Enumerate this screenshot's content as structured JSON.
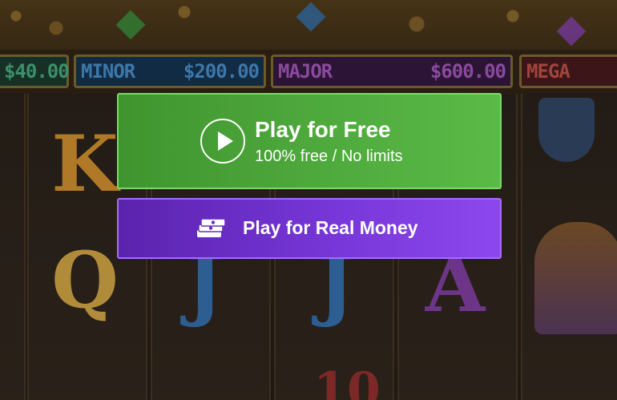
{
  "jackpots": {
    "mini": {
      "value": "$40.00"
    },
    "minor": {
      "label": "MINOR",
      "value": "$200.00"
    },
    "major": {
      "label": "MAJOR",
      "value": "$600.00"
    },
    "mega": {
      "label": "MEGA"
    }
  },
  "reel_symbols": [
    "K",
    "Q",
    "J",
    "J",
    "A",
    "10"
  ],
  "overlay": {
    "free": {
      "title": "Play for Free",
      "subtitle": "100% free / No limits",
      "icon": "play-circle-icon"
    },
    "real": {
      "title": "Play for Real Money",
      "icon": "cash-stack-icon"
    }
  },
  "colors": {
    "free_button": "#4ea83c",
    "real_button": "#7434d4",
    "text": "#ffffff"
  }
}
